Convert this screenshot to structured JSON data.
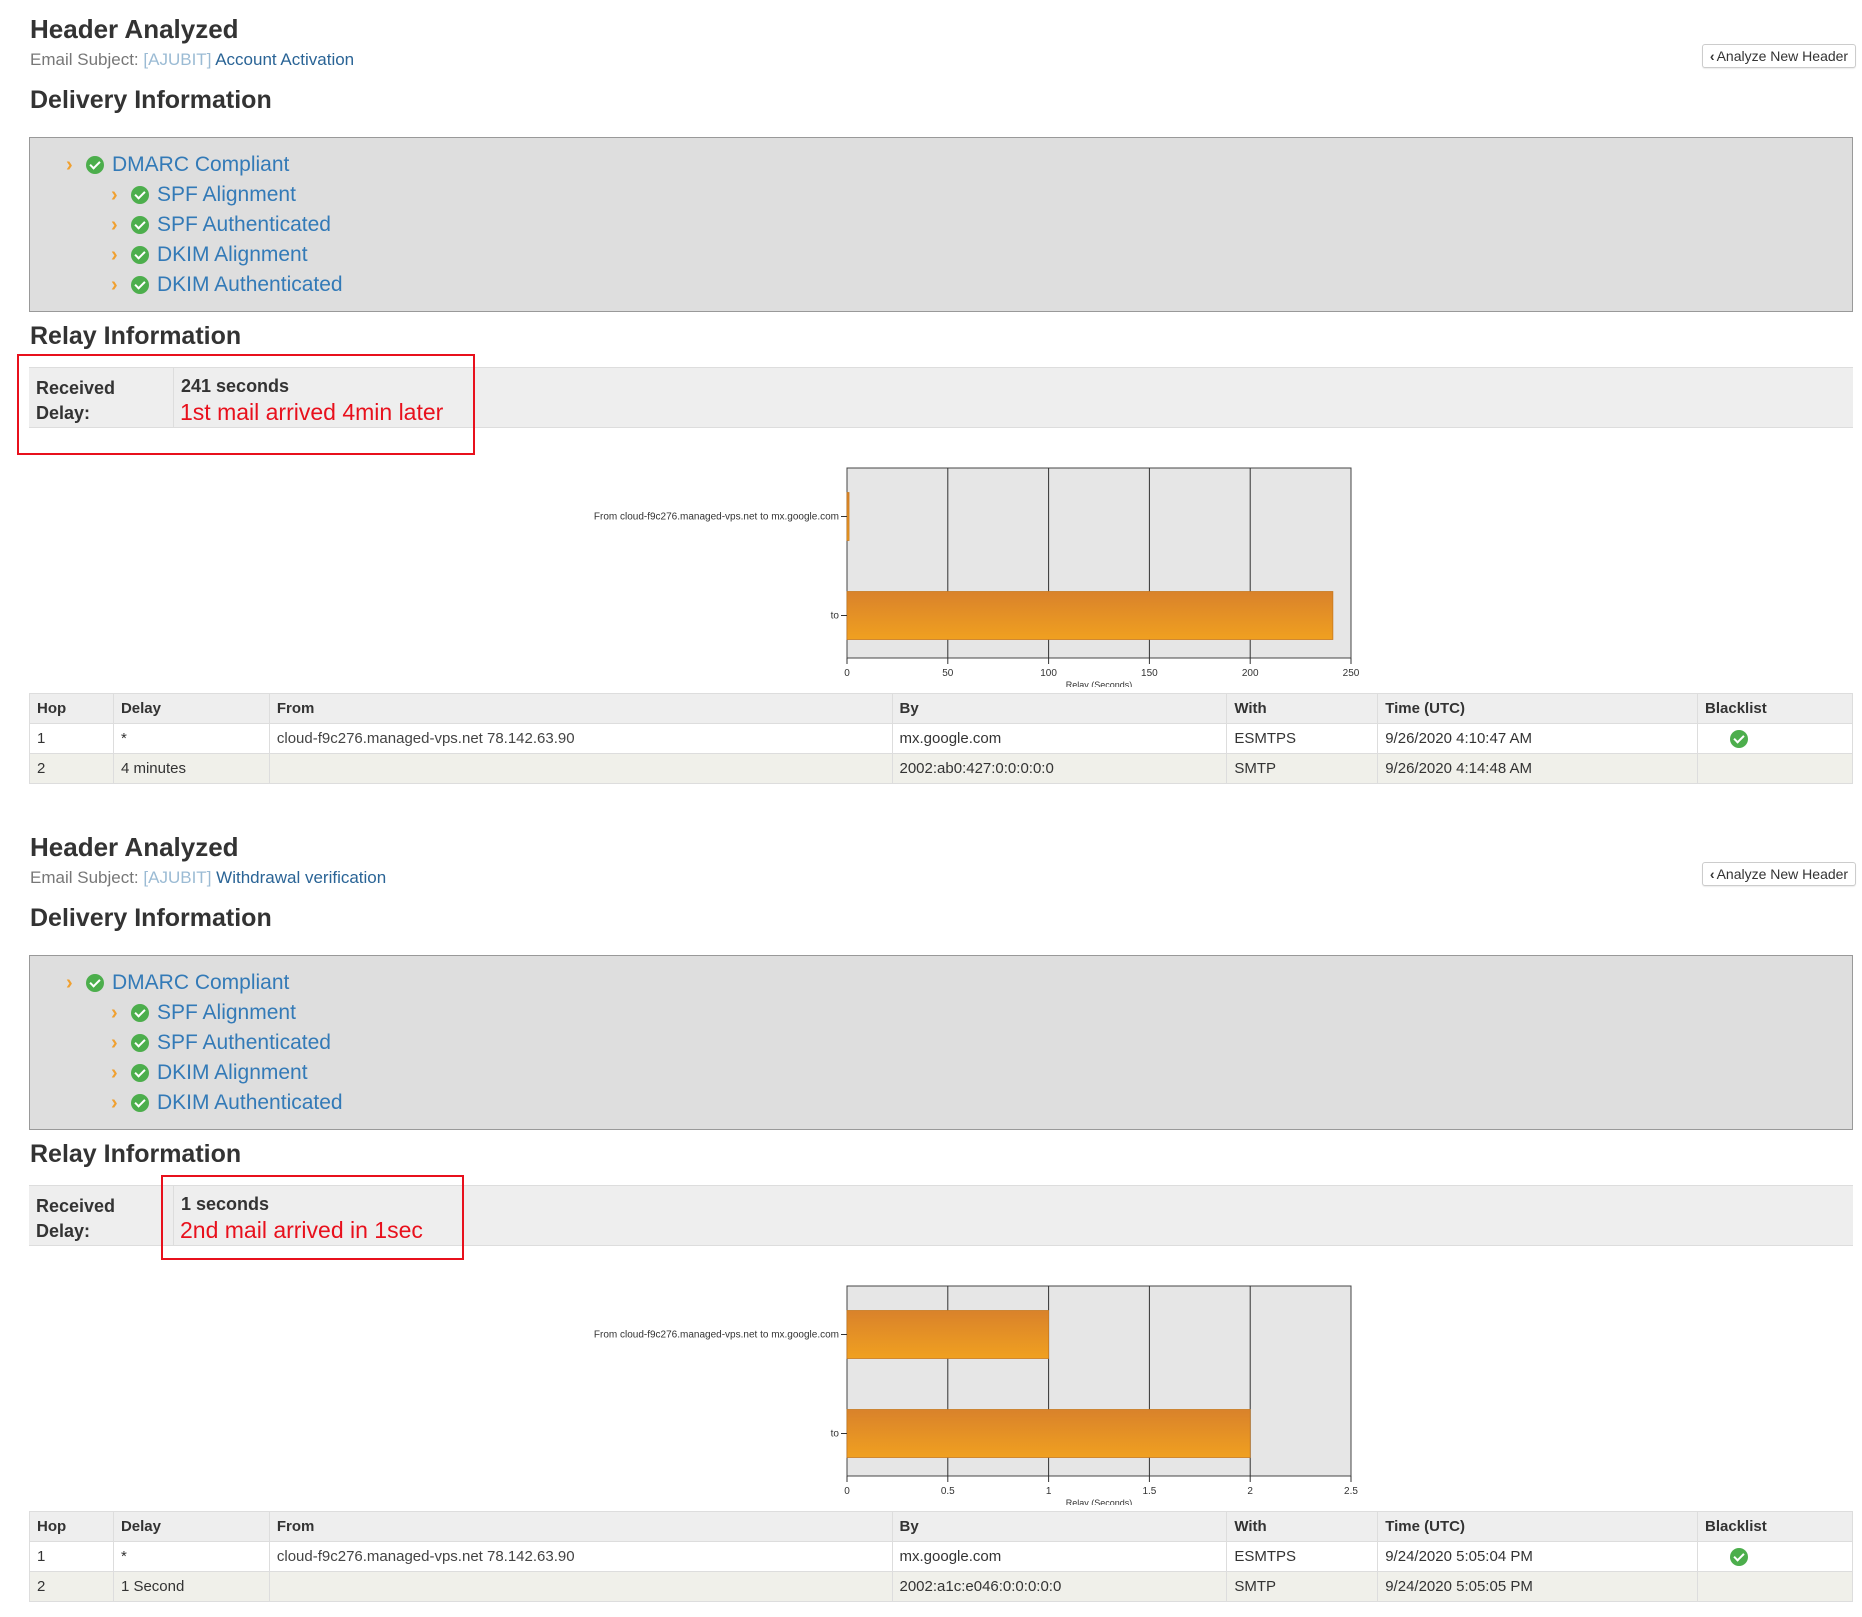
{
  "reports": [
    {
      "title": "Header Analyzed",
      "subject_label": "Email Subject:",
      "subject_redacted": "[AJUBIT]",
      "subject_text": "Account Activation",
      "analyze_button": "Analyze New Header",
      "delivery_heading": "Delivery Information",
      "checks": [
        "DMARC Compliant",
        "SPF Alignment",
        "SPF Authenticated",
        "DKIM Alignment",
        "DKIM Authenticated"
      ],
      "relay_heading": "Relay Information",
      "received_delay_label": "Received Delay:",
      "received_delay_value": "241 seconds",
      "note": "1st mail arrived 4min later",
      "chart_data": {
        "type": "bar",
        "orientation": "horizontal",
        "categories": [
          "From cloud-f9c276.managed-vps.net to mx.google.com",
          "to"
        ],
        "values": [
          1,
          241
        ],
        "xlabel": "Relay (Seconds)",
        "ylabel": "",
        "xlim": [
          0,
          250
        ],
        "xticks": [
          "0",
          "50",
          "100",
          "150",
          "200",
          "250"
        ],
        "grid": true,
        "bar_color": "#f0a020"
      },
      "table": {
        "headers": [
          "Hop",
          "Delay",
          "From",
          "By",
          "With",
          "Time (UTC)",
          "Blacklist"
        ],
        "rows": [
          {
            "hop": "1",
            "delay": "*",
            "from": "cloud-f9c276.managed-vps.net 78.142.63.90",
            "by": "mx.google.com",
            "with": "ESMTPS",
            "time": "9/26/2020 4:10:47 AM",
            "blacklist": "ok"
          },
          {
            "hop": "2",
            "delay": "4 minutes",
            "from": "",
            "by": "2002:ab0:427:0:0:0:0:0",
            "with": "SMTP",
            "time": "9/26/2020 4:14:48 AM",
            "blacklist": ""
          }
        ]
      }
    },
    {
      "title": "Header Analyzed",
      "subject_label": "Email Subject:",
      "subject_redacted": "[AJUBIT]",
      "subject_text": "Withdrawal verification",
      "analyze_button": "Analyze New Header",
      "delivery_heading": "Delivery Information",
      "checks": [
        "DMARC Compliant",
        "SPF Alignment",
        "SPF Authenticated",
        "DKIM Alignment",
        "DKIM Authenticated"
      ],
      "relay_heading": "Relay Information",
      "received_delay_label": "Received Delay:",
      "received_delay_value": "1 seconds",
      "note": "2nd mail arrived in 1sec",
      "chart_data": {
        "type": "bar",
        "orientation": "horizontal",
        "categories": [
          "From cloud-f9c276.managed-vps.net to mx.google.com",
          "to"
        ],
        "values": [
          1,
          2
        ],
        "xlabel": "Relay (Seconds)",
        "ylabel": "",
        "xlim": [
          0,
          2.5
        ],
        "xticks": [
          "0",
          "0.5",
          "1",
          "1.5",
          "2",
          "2.5"
        ],
        "grid": true,
        "bar_color": "#f0a020"
      },
      "table": {
        "headers": [
          "Hop",
          "Delay",
          "From",
          "By",
          "With",
          "Time (UTC)",
          "Blacklist"
        ],
        "rows": [
          {
            "hop": "1",
            "delay": "*",
            "from": "cloud-f9c276.managed-vps.net 78.142.63.90",
            "by": "mx.google.com",
            "with": "ESMTPS",
            "time": "9/24/2020 5:05:04 PM",
            "blacklist": "ok"
          },
          {
            "hop": "2",
            "delay": "1 Second",
            "from": "",
            "by": "2002:a1c:e046:0:0:0:0:0",
            "with": "SMTP",
            "time": "9/24/2020 5:05:05 PM",
            "blacklist": ""
          }
        ]
      }
    }
  ]
}
